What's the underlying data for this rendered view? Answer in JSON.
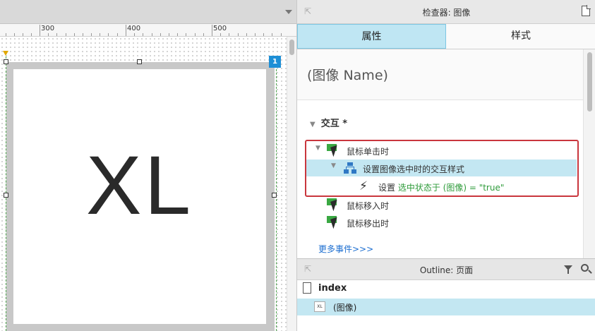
{
  "canvas": {
    "ruler_marks": [
      "300",
      "400",
      "500"
    ],
    "image_text": "XL",
    "badge": "1"
  },
  "inspector": {
    "title": "检查器: 图像",
    "tabs": [
      "属性",
      "样式"
    ],
    "selected_tab": "属性",
    "name_placeholder": "(图像 Name)",
    "section_label": "交互 *",
    "events": {
      "onclick": "鼠标单击时",
      "case": "设置图像选中时的交互样式",
      "action_prefix": "设置",
      "action_detail": "选中状态于 (图像) = \"true\"",
      "mouse_enter": "鼠标移入时",
      "mouse_leave": "鼠标移出时"
    },
    "more_events": "更多事件>>>"
  },
  "outline": {
    "title": "Outline: 页面",
    "page": "index",
    "item_thumb": "XL",
    "item": "(图像)"
  },
  "colors": {
    "tab_selected": "#bfe6f3",
    "highlight": "#c3e7f2",
    "accent_green": "#2e9b3a",
    "red_outline": "#c9363d",
    "link_blue": "#1c6ed0",
    "badge_blue": "#1e8fd6"
  }
}
